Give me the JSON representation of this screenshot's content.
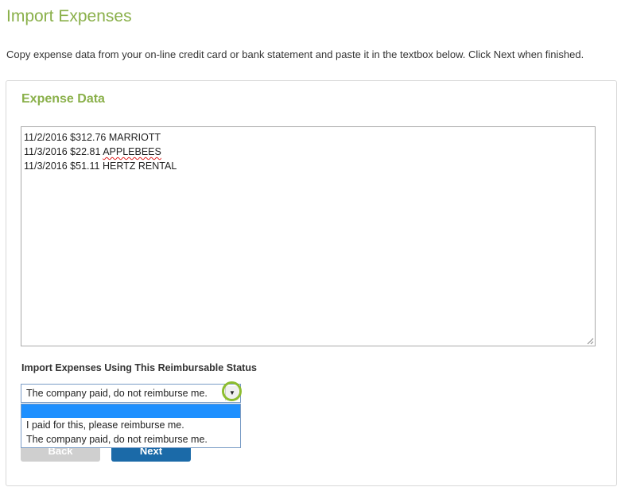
{
  "page": {
    "title": "Import Expenses",
    "instructions": "Copy expense data from your on-line credit card or bank statement and paste it in the textbox below. Click Next when finished."
  },
  "panel": {
    "title": "Expense Data",
    "expense_lines": [
      {
        "date": "11/2/2016",
        "amount": "$312.76",
        "merchant": "MARRIOTT"
      },
      {
        "date": "11/3/2016",
        "amount": "$22.81",
        "merchant": "APPLEBEES"
      },
      {
        "date": "11/3/2016",
        "amount": "$51.11",
        "merchant": "HERTZ RENTAL"
      }
    ],
    "status_label": "Import Expenses Using This Reimbursable Status",
    "status_select": {
      "value": "The company paid, do not reimburse me.",
      "options": [
        "",
        "I paid for this, please reimburse me.",
        "The company paid, do not reimburse me."
      ],
      "highlighted_option_index": 0
    },
    "buttons": {
      "back": "Back",
      "next": "Next"
    }
  },
  "colors": {
    "title_green": "#8ab04a",
    "next_blue": "#1b6aa8",
    "back_gray": "#cfcfcf",
    "highlight_ring": "#8dbd2f",
    "option_highlight": "#1e90ff"
  },
  "icons": {
    "select_arrow": "dropdown-arrow-icon",
    "resize_grip": "resize-grip-icon"
  }
}
